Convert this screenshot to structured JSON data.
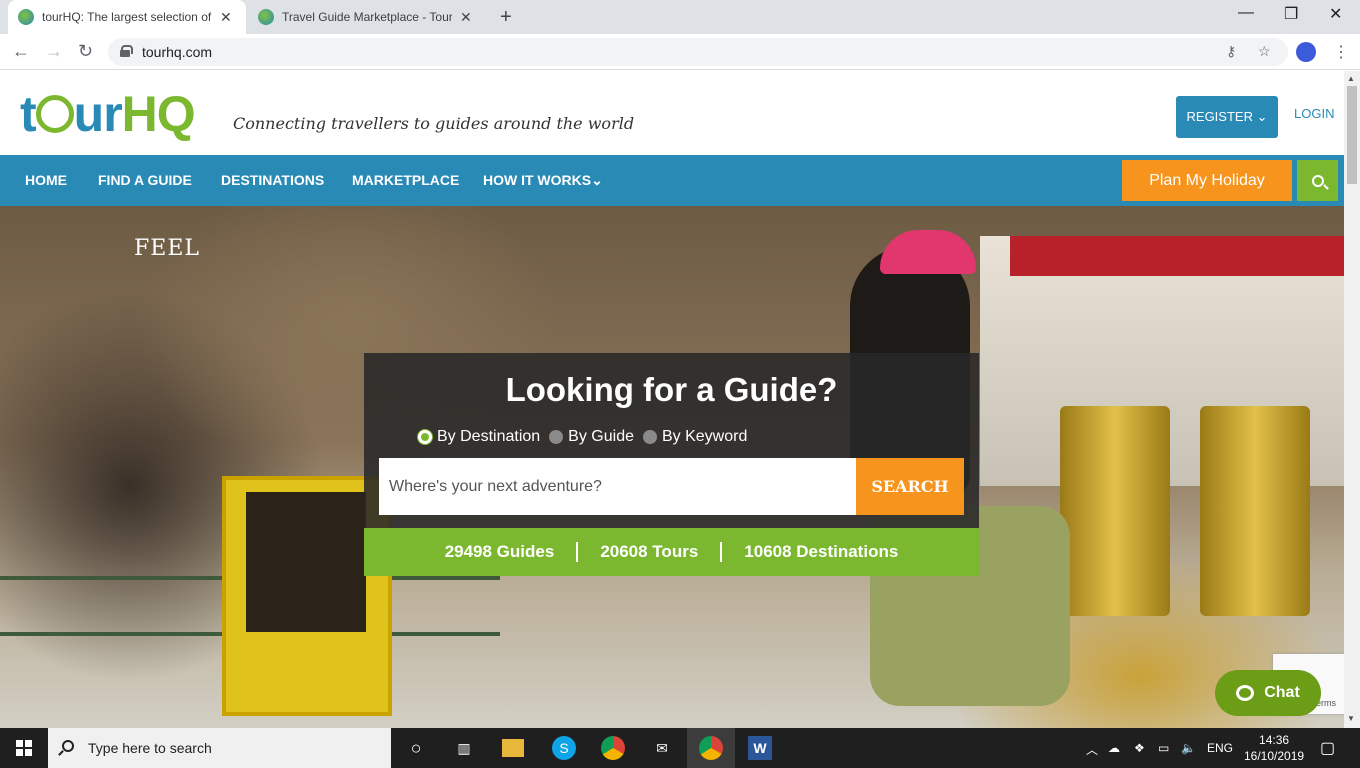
{
  "browser": {
    "tabs": [
      {
        "title": "tourHQ: The largest selection of local guides",
        "close": "✕"
      },
      {
        "title": "Travel Guide Marketplace - Tour Guides",
        "close": "✕"
      }
    ],
    "new_tab": "+",
    "window_controls": {
      "minimize": "—",
      "maximize": "❐",
      "close": "✕"
    },
    "nav": {
      "back": "←",
      "forward": "→",
      "reload": "↻"
    },
    "url": "tourhq.com",
    "menu": "⋮"
  },
  "site": {
    "logo_part1": "t",
    "logo_part2": "ur",
    "logo_part3": "HQ",
    "tagline": "Connecting travellers to guides around the world",
    "register": "REGISTER ⌄",
    "login": "LOGIN",
    "nav": [
      "HOME",
      "FIND A GUIDE",
      "DESTINATIONS",
      "MARKETPLACE",
      "HOW IT WORKS⌄"
    ],
    "plan_button": "Plan My Holiday"
  },
  "hero": {
    "overlay_word": "FEEL",
    "title": "Looking for a Guide?",
    "radios": [
      "By Destination",
      "By Guide",
      "By Keyword"
    ],
    "selected_radio": "By Destination",
    "search_placeholder": "Where's your next adventure?",
    "search_button": "SEARCH",
    "stats": [
      "29498 Guides",
      "20608 Tours",
      "10608 Destinations"
    ],
    "recaptcha_terms": "Terms",
    "chat_label": "Chat"
  },
  "taskbar": {
    "search_text": "Type here to search",
    "language": "ENG",
    "time": "14:36",
    "date": "16/10/2019"
  },
  "colors": {
    "brand_blue": "#2a8ab6",
    "brand_green": "#7cb82f",
    "brand_orange": "#f7941d"
  }
}
